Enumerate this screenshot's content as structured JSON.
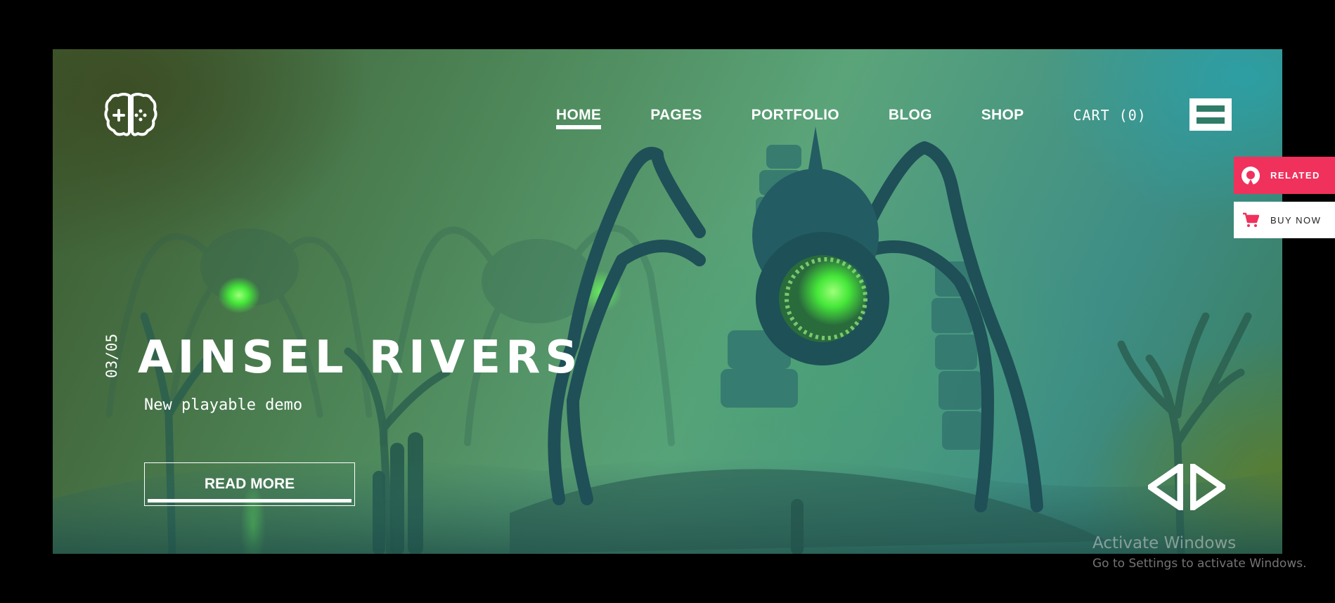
{
  "colors": {
    "accent": "#f0315c",
    "text": "#ffffff",
    "menu_bar": "#2f7c69",
    "background": "#000000"
  },
  "logo": {
    "icon": "brain-gamepad-icon"
  },
  "nav": {
    "items": [
      {
        "label": "HOME",
        "active": true
      },
      {
        "label": "PAGES",
        "active": false
      },
      {
        "label": "PORTFOLIO",
        "active": false
      },
      {
        "label": "BLOG",
        "active": false
      },
      {
        "label": "SHOP",
        "active": false
      }
    ],
    "cart_label": "CART (0)",
    "menu_icon": "hamburger-menu-icon"
  },
  "hero": {
    "slide_counter": "03/05",
    "title": "AINSEL RIVERS",
    "subtitle": "New playable demo",
    "cta_label": "READ MORE",
    "prev_icon": "chevron-left-icon",
    "next_icon": "chevron-right-icon"
  },
  "side_widgets": {
    "related_label": "RELATED",
    "related_icon": "related-icon",
    "buy_label": "BUY NOW",
    "buy_icon": "cart-icon"
  },
  "watermark": {
    "title": "Activate Windows",
    "subtitle": "Go to Settings to activate Windows."
  }
}
